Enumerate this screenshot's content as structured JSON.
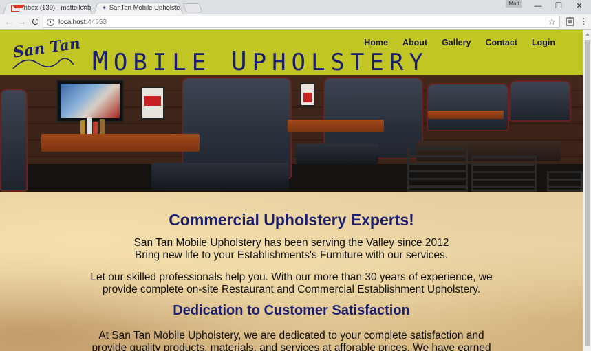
{
  "browser": {
    "tabs": [
      {
        "title": "Inbox (139) - mattellenb",
        "close": "×",
        "icon": "gmail-icon"
      },
      {
        "title": "SanTan Mobile Upholste",
        "close": "×",
        "icon": "santan-favicon"
      }
    ],
    "user": "Matt",
    "window_controls": {
      "minimize": "—",
      "maximize": "❐",
      "close": "✕"
    },
    "nav": {
      "back": "←",
      "forward": "→",
      "reload": "C"
    },
    "address": {
      "host": "localhost",
      "port": ":44953"
    },
    "bookmark_star": "☆",
    "menu": "⋮"
  },
  "site": {
    "logo_text": "San Tan",
    "brand_first": "M",
    "brand_rest": "OBILE ",
    "brand_second": "U",
    "brand_rest2": "PHOLSTERY",
    "nav": [
      "Home",
      "About",
      "Gallery",
      "Contact",
      "Login"
    ],
    "header_color": "#c2c625",
    "title_color": "#1c1e6e"
  },
  "content": {
    "heading": "Commercial Upholstery Experts!",
    "line1": "San Tan Mobile Upholstery has been serving the Valley since 2012",
    "line2": "Bring new life to your Establishments's Furniture with our services.",
    "line3": "Let our skilled professionals help you. With our more than 30 years of experience, we",
    "line4": "provide complete on-site Restaurant and Commercial Establishment Upholstery.",
    "subheading": "Dedication to Customer Satisfaction",
    "line5": "At San Tan Mobile Upholstery, we are dedicated to your complete satisfaction and",
    "line6": "provide quality products, materials, and services at afforable prices. We have earned"
  }
}
